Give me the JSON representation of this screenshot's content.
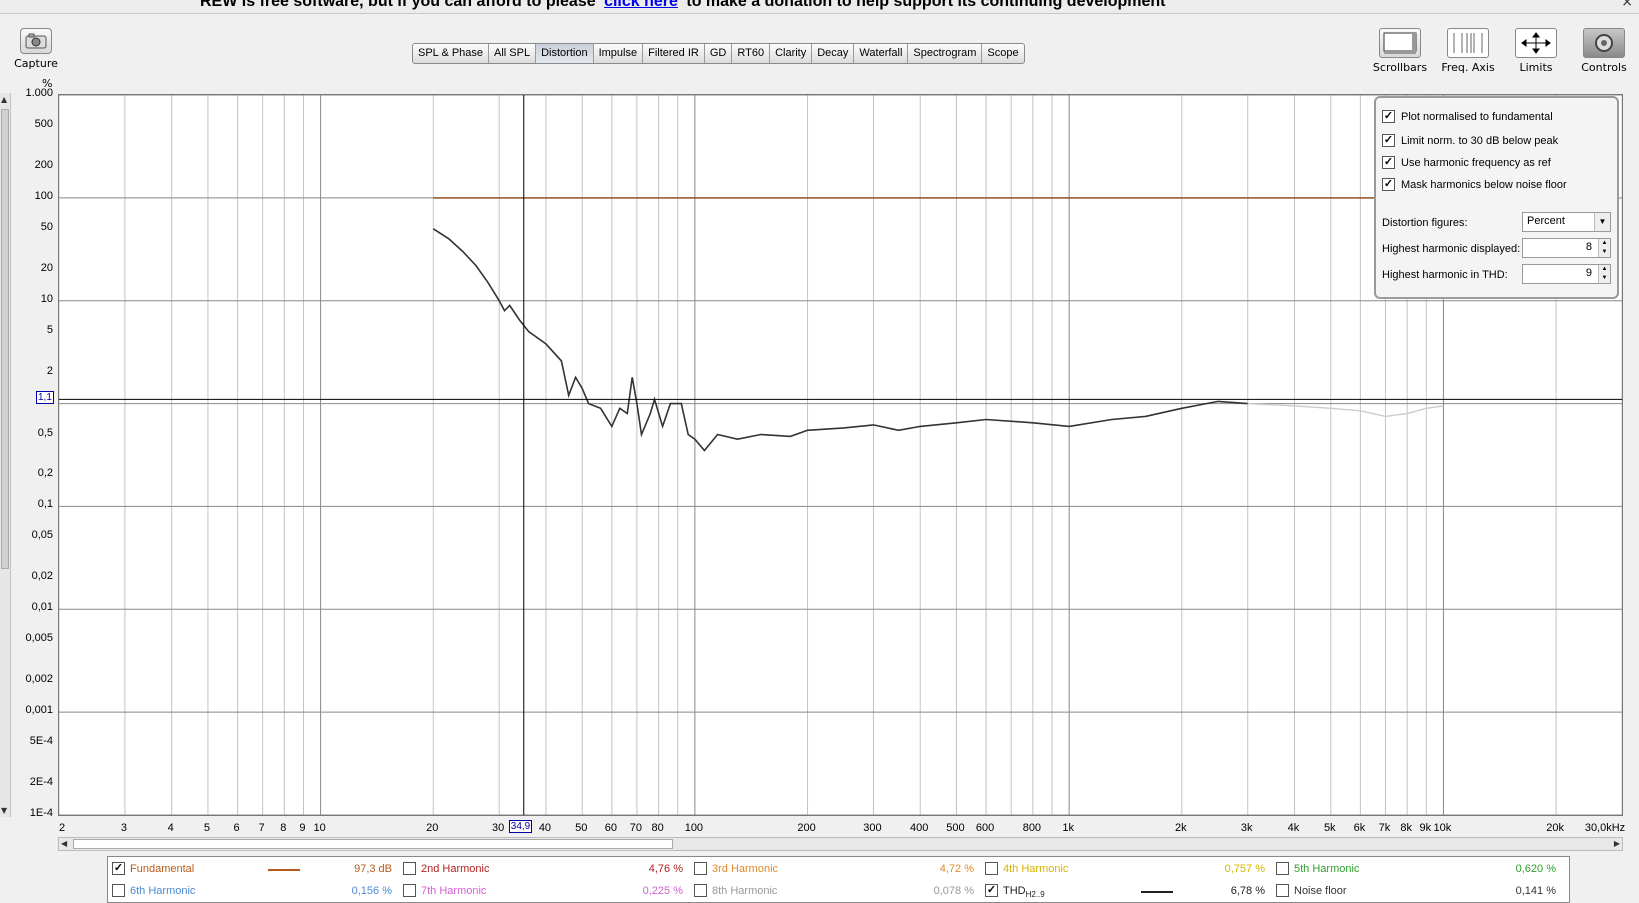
{
  "banner": {
    "text_before": "REW is free software, but if you can afford to please",
    "link": "click here",
    "text_after": "to make a donation to help support its continuing development",
    "close": "×"
  },
  "toolbar": {
    "capture_label": "Capture",
    "tabs": [
      "SPL & Phase",
      "All SPL",
      "Distortion",
      "Impulse",
      "Filtered IR",
      "GD",
      "RT60",
      "Clarity",
      "Decay",
      "Waterfall",
      "Spectrogram",
      "Scope"
    ],
    "active_tab": "Distortion",
    "right": [
      {
        "label": "Scrollbars",
        "icon": "scrollbars-icon"
      },
      {
        "label": "Freq. Axis",
        "icon": "freq-axis-icon"
      },
      {
        "label": "Limits",
        "icon": "limits-icon"
      },
      {
        "label": "Controls",
        "icon": "controls-icon"
      }
    ]
  },
  "graph": {
    "y_unit": "%",
    "cursor_y_value": "1,1",
    "cursor_x_value": "34,9"
  },
  "chart_data": {
    "type": "line",
    "title": "",
    "xlabel": "",
    "ylabel": "%",
    "x_scale": "log",
    "y_scale": "log",
    "xlim": [
      2,
      30000
    ],
    "ylim": [
      0.0001,
      1000
    ],
    "grid": true,
    "y_tick_labels": [
      {
        "v": 1000,
        "t": "1.000"
      },
      {
        "v": 500,
        "t": "500"
      },
      {
        "v": 200,
        "t": "200"
      },
      {
        "v": 100,
        "t": "100"
      },
      {
        "v": 50,
        "t": "50"
      },
      {
        "v": 20,
        "t": "20"
      },
      {
        "v": 10,
        "t": "10"
      },
      {
        "v": 5,
        "t": "5"
      },
      {
        "v": 2,
        "t": "2"
      },
      {
        "v": 0.5,
        "t": "0,5"
      },
      {
        "v": 0.2,
        "t": "0,2"
      },
      {
        "v": 0.1,
        "t": "0,1"
      },
      {
        "v": 0.05,
        "t": "0,05"
      },
      {
        "v": 0.02,
        "t": "0,02"
      },
      {
        "v": 0.01,
        "t": "0,01"
      },
      {
        "v": 0.005,
        "t": "0,005"
      },
      {
        "v": 0.002,
        "t": "0,002"
      },
      {
        "v": 0.001,
        "t": "0,001"
      },
      {
        "v": 0.0005,
        "t": "5E-4"
      },
      {
        "v": 0.0002,
        "t": "2E-4"
      },
      {
        "v": 0.0001,
        "t": "1E-4"
      }
    ],
    "x_tick_labels": [
      {
        "v": 2,
        "t": "2"
      },
      {
        "v": 3,
        "t": "3"
      },
      {
        "v": 4,
        "t": "4"
      },
      {
        "v": 5,
        "t": "5"
      },
      {
        "v": 6,
        "t": "6"
      },
      {
        "v": 7,
        "t": "7"
      },
      {
        "v": 8,
        "t": "8"
      },
      {
        "v": 9,
        "t": "9"
      },
      {
        "v": 10,
        "t": "10"
      },
      {
        "v": 20,
        "t": "20"
      },
      {
        "v": 30,
        "t": "30"
      },
      {
        "v": 40,
        "t": "40"
      },
      {
        "v": 50,
        "t": "50"
      },
      {
        "v": 60,
        "t": "60"
      },
      {
        "v": 70,
        "t": "70"
      },
      {
        "v": 80,
        "t": "80"
      },
      {
        "v": 100,
        "t": "100"
      },
      {
        "v": 200,
        "t": "200"
      },
      {
        "v": 300,
        "t": "300"
      },
      {
        "v": 400,
        "t": "400"
      },
      {
        "v": 500,
        "t": "500"
      },
      {
        "v": 600,
        "t": "600"
      },
      {
        "v": 800,
        "t": "800"
      },
      {
        "v": 1000,
        "t": "1k"
      },
      {
        "v": 2000,
        "t": "2k"
      },
      {
        "v": 3000,
        "t": "3k"
      },
      {
        "v": 4000,
        "t": "4k"
      },
      {
        "v": 5000,
        "t": "5k"
      },
      {
        "v": 6000,
        "t": "6k"
      },
      {
        "v": 7000,
        "t": "7k"
      },
      {
        "v": 8000,
        "t": "8k"
      },
      {
        "v": 9000,
        "t": "9k"
      },
      {
        "v": 10000,
        "t": "10k"
      },
      {
        "v": 20000,
        "t": "20k"
      },
      {
        "v": 30000,
        "t": "30,0kHz"
      }
    ],
    "series": [
      {
        "name": "Fundamental",
        "color": "#8b4513",
        "points": [
          [
            20,
            100
          ],
          [
            20000,
            100
          ]
        ]
      },
      {
        "name": "THD",
        "color": "#333333",
        "points": [
          [
            20,
            50
          ],
          [
            22,
            40
          ],
          [
            24,
            30
          ],
          [
            26,
            22
          ],
          [
            28,
            15
          ],
          [
            30,
            10
          ],
          [
            31,
            8
          ],
          [
            32,
            9
          ],
          [
            34,
            6.5
          ],
          [
            36,
            5
          ],
          [
            40,
            3.8
          ],
          [
            44,
            2.6
          ],
          [
            46,
            1.2
          ],
          [
            48,
            1.8
          ],
          [
            50,
            1.4
          ],
          [
            52,
            1.0
          ],
          [
            56,
            0.9
          ],
          [
            60,
            0.6
          ],
          [
            63,
            0.9
          ],
          [
            66,
            0.8
          ],
          [
            68,
            1.8
          ],
          [
            70,
            1.0
          ],
          [
            72,
            0.5
          ],
          [
            76,
            0.8
          ],
          [
            78,
            1.1
          ],
          [
            82,
            0.6
          ],
          [
            86,
            1.0
          ],
          [
            92,
            1.0
          ],
          [
            96,
            0.5
          ],
          [
            100,
            0.45
          ],
          [
            106,
            0.35
          ],
          [
            115,
            0.5
          ],
          [
            130,
            0.45
          ],
          [
            150,
            0.5
          ],
          [
            180,
            0.48
          ],
          [
            200,
            0.55
          ],
          [
            250,
            0.58
          ],
          [
            300,
            0.62
          ],
          [
            350,
            0.55
          ],
          [
            400,
            0.6
          ],
          [
            500,
            0.65
          ],
          [
            600,
            0.7
          ],
          [
            800,
            0.65
          ],
          [
            1000,
            0.6
          ],
          [
            1300,
            0.7
          ],
          [
            1600,
            0.75
          ],
          [
            2000,
            0.9
          ],
          [
            2500,
            1.05
          ],
          [
            3000,
            1.0
          ]
        ]
      },
      {
        "name": "THD (masked)",
        "color": "#cccccc",
        "points": [
          [
            3000,
            1.0
          ],
          [
            4000,
            0.95
          ],
          [
            5000,
            0.9
          ],
          [
            6000,
            0.85
          ],
          [
            7000,
            0.75
          ],
          [
            8000,
            0.8
          ],
          [
            9000,
            0.9
          ],
          [
            10000,
            0.95
          ]
        ]
      }
    ],
    "cursor": {
      "x": 34.9,
      "y": 1.1
    }
  },
  "controls": {
    "checks": [
      {
        "label": "Plot normalised to fundamental",
        "checked": true
      },
      {
        "label": "Limit norm. to 30 dB below peak",
        "checked": true
      },
      {
        "label": "Use harmonic frequency as ref",
        "checked": true
      },
      {
        "label": "Mask harmonics below noise floor",
        "checked": true
      }
    ],
    "distortion_figures_label": "Distortion figures:",
    "distortion_figures_value": "Percent",
    "highest_displayed_label": "Highest harmonic displayed:",
    "highest_displayed_value": "8",
    "highest_thd_label": "Highest harmonic in THD:",
    "highest_thd_value": "9"
  },
  "legend": [
    {
      "name": "Fundamental",
      "value": "97,3 dB",
      "checked": true,
      "color": "#b85a1a",
      "line": true
    },
    {
      "name": "2nd Harmonic",
      "value": "4,76 %",
      "checked": false,
      "color": "#b22222"
    },
    {
      "name": "3rd Harmonic",
      "value": "4,72 %",
      "checked": false,
      "color": "#e08a2a"
    },
    {
      "name": "4th Harmonic",
      "value": "0,757 %",
      "checked": false,
      "color": "#d4b400"
    },
    {
      "name": "5th Harmonic",
      "value": "0,620 %",
      "checked": false,
      "color": "#2e9e2e"
    },
    {
      "name": "6th Harmonic",
      "value": "0,156 %",
      "checked": false,
      "color": "#4a8ad6"
    },
    {
      "name": "7th Harmonic",
      "value": "0,225 %",
      "checked": false,
      "color": "#d35fd3"
    },
    {
      "name": "8th Harmonic",
      "value": "0,078 %",
      "checked": false,
      "color": "#999999"
    },
    {
      "name": "THD",
      "sub": "H2..9",
      "value": "6,78 %",
      "checked": true,
      "color": "#222222",
      "line": true
    },
    {
      "name": "Noise floor",
      "value": "0,141 %",
      "checked": false,
      "color": "#333333"
    }
  ]
}
